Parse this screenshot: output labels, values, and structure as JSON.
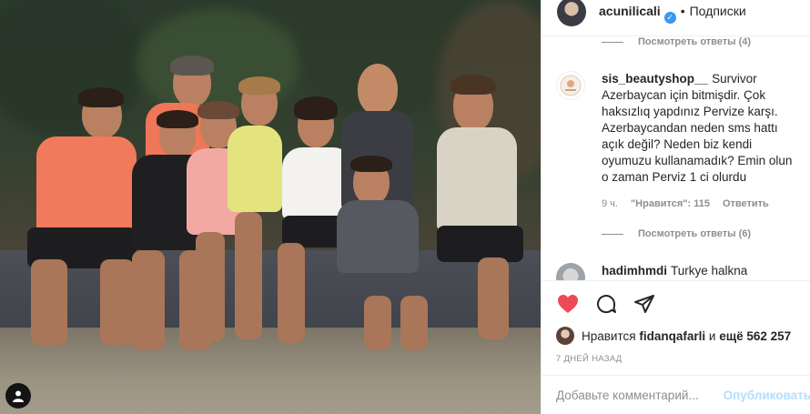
{
  "post": {
    "author": "acunilicali",
    "separator": "•",
    "follow_label": "Подписки"
  },
  "comments": {
    "replies_1": "Посмотреть ответы (4)",
    "comment_1": {
      "user": "sis_beautyshop__",
      "text": "Survivor Azerbaycan için bitmişdir. Çok haksızlıq yapdınız Pervize karşı. Azerbaycandan neden sms hattı açık değil? Neden biz kendi oyumuzu kullanamadık? Emin olun o zaman Perviz 1 ci olurdu",
      "time": "9 ч.",
      "likes": "\"Нравится\": 115",
      "reply": "Ответить"
    },
    "replies_2": "Посмотреть ответы (6)",
    "comment_2": {
      "user": "hadimhmdi",
      "text": "Turkye halkna"
    }
  },
  "actions": {
    "like_icon": "heart-icon",
    "comment_icon": "comment-icon",
    "share_icon": "share-icon",
    "liked_prefix": "Нравится",
    "liked_user": "fidanqafarli",
    "liked_and": "и",
    "liked_more": "ещё 562 257",
    "date": "7 ДНЕЙ НАЗАД"
  },
  "add_comment": {
    "placeholder": "Добавьте комментарий...",
    "publish": "Опубликовать"
  },
  "colors": {
    "heart": "#ed4956",
    "verified": "#3897f0",
    "publish_disabled": "#b2dffc",
    "muted": "#8e8e8e"
  }
}
